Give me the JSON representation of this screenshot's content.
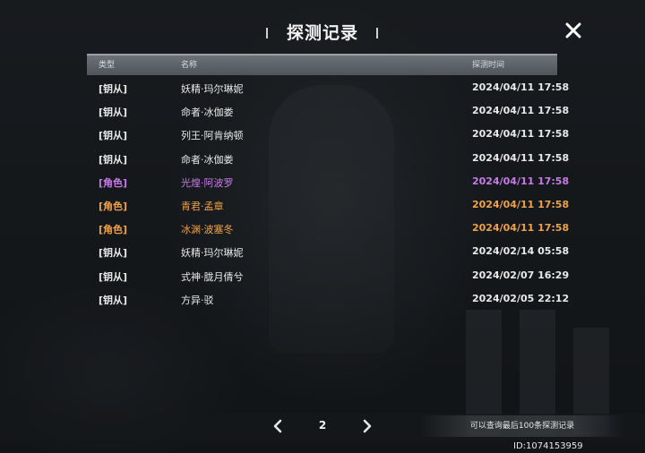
{
  "title": "探测记录",
  "columns": {
    "type": "类型",
    "name": "名称",
    "time": "探测时间"
  },
  "colors": {
    "key": "#e9e9e9",
    "purple": "#c77be8",
    "gold": "#f0a246"
  },
  "records": [
    {
      "type": "[钥从]",
      "name": "妖精·玛尔琳妮",
      "time": "2024/04/11 17:58",
      "color": "#e9e9e9"
    },
    {
      "type": "[钥从]",
      "name": "命者·冰伽娄",
      "time": "2024/04/11 17:58",
      "color": "#e9e9e9"
    },
    {
      "type": "[钥从]",
      "name": "列王·阿肯纳顿",
      "time": "2024/04/11 17:58",
      "color": "#e9e9e9"
    },
    {
      "type": "[钥从]",
      "name": "命者·冰伽娄",
      "time": "2024/04/11 17:58",
      "color": "#e9e9e9"
    },
    {
      "type": "[角色]",
      "name": "光煌·阿波罗",
      "time": "2024/04/11 17:58",
      "color": "#c77be8"
    },
    {
      "type": "[角色]",
      "name": "青君·孟章",
      "time": "2024/04/11 17:58",
      "color": "#f0a246"
    },
    {
      "type": "[角色]",
      "name": "冰渊·波塞冬",
      "time": "2024/04/11 17:58",
      "color": "#f0a246"
    },
    {
      "type": "[钥从]",
      "name": "妖精·玛尔琳妮",
      "time": "2024/02/14 05:58",
      "color": "#e9e9e9"
    },
    {
      "type": "[钥从]",
      "name": "式神·胧月倩兮",
      "time": "2024/02/07 16:29",
      "color": "#e9e9e9"
    },
    {
      "type": "[钥从]",
      "name": "方异·驳",
      "time": "2024/02/05 22:12",
      "color": "#e9e9e9"
    }
  ],
  "pager": {
    "page": "2"
  },
  "note": "可以查询最后100条探测记录",
  "uid": "ID:1074153959",
  "icons": {
    "close": "close-icon",
    "prev": "chevron-left-icon",
    "next": "chevron-right-icon"
  }
}
